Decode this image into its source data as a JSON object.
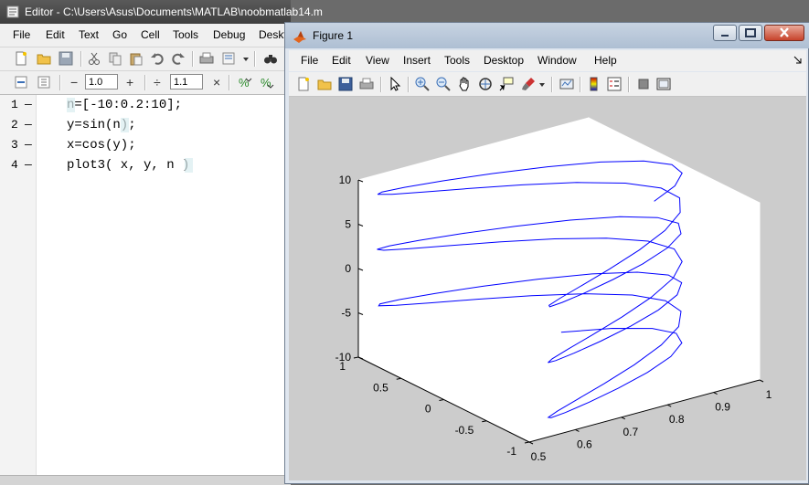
{
  "editor": {
    "title": "Editor - C:\\Users\\Asus\\Documents\\MATLAB\\noobmatlab14.m",
    "menu": [
      "File",
      "Edit",
      "Text",
      "Go",
      "Cell",
      "Tools",
      "Debug",
      "Deskt"
    ],
    "cell_step_value": "1.0",
    "cell_divide_value": "1.1",
    "lines": [
      {
        "num": "1",
        "code": "n=[-10:0.2:10];"
      },
      {
        "num": "2",
        "code": "y=sin(n);"
      },
      {
        "num": "3",
        "code": "x=cos(y);"
      },
      {
        "num": "4",
        "code": "plot3( x, y, n )"
      }
    ]
  },
  "figure": {
    "title": "Figure 1",
    "menu": [
      "File",
      "Edit",
      "View",
      "Insert",
      "Tools",
      "Desktop",
      "Window",
      "Help"
    ],
    "toolbar_icons": [
      "new-figure-icon",
      "open-file-icon",
      "save-icon",
      "print-icon",
      "pointer-icon",
      "zoom-in-icon",
      "zoom-out-icon",
      "pan-icon",
      "rotate-3d-icon",
      "data-cursor-icon",
      "brush-icon",
      "link-plot-icon",
      "colorbar-icon",
      "legend-icon",
      "hide-plot-tools-icon",
      "show-plot-tools-icon"
    ]
  },
  "chart_data": {
    "type": "line",
    "title": "",
    "xlabel": "",
    "ylabel": "",
    "zlabel": "",
    "x_ticks": [
      "0.5",
      "0.6",
      "0.7",
      "0.8",
      "0.9",
      "1"
    ],
    "y_ticks": [
      "-1",
      "-0.5",
      "0",
      "0.5",
      "1"
    ],
    "z_ticks": [
      "-10",
      "-5",
      "0",
      "5",
      "10"
    ],
    "xlim": [
      0.5,
      1
    ],
    "ylim": [
      -1,
      1
    ],
    "zlim": [
      -10,
      10
    ],
    "series": [
      {
        "expression": "plot3(x, y, n)",
        "n_range": [
          -10,
          10
        ],
        "n_step": 0.2,
        "y": "sin(n)",
        "x": "cos(y)",
        "color": "#0000ff"
      }
    ],
    "grid": false,
    "view": "3d"
  }
}
